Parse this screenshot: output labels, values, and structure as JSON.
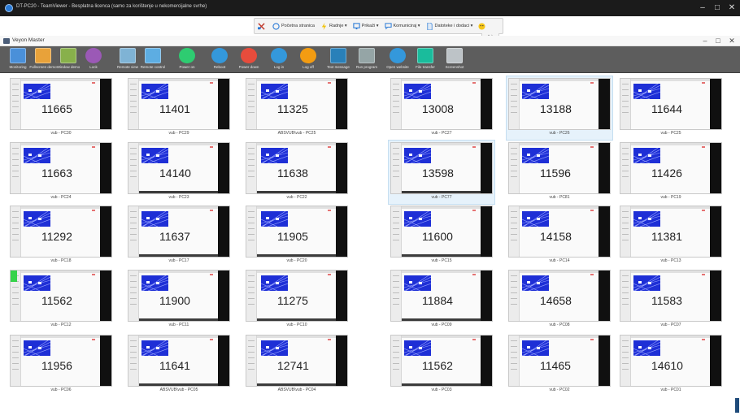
{
  "teamviewer": {
    "title": "DT-PC20 - TeamViewer - Besplatna licenca (samo za korištenje u nekomercijalne svrhe)",
    "toolbar": [
      {
        "label": "Početna stranica",
        "icon": "home-icon"
      },
      {
        "label": "Radnje",
        "icon": "bolt-icon"
      },
      {
        "label": "Prikaži",
        "icon": "monitor-icon"
      },
      {
        "label": "Komuniciraj",
        "icon": "chat-icon"
      },
      {
        "label": "Datoteke i dodaci",
        "icon": "file-icon"
      }
    ]
  },
  "veyon": {
    "title": "Veyon Master",
    "toolbar": [
      {
        "label": "Monitoring",
        "icon": "monitoring-icon",
        "color": "#4a90d9"
      },
      {
        "label": "Fullscreen demo",
        "icon": "fullscreen-demo-icon",
        "color": "#e8a23a"
      },
      {
        "label": "Window demo",
        "icon": "window-demo-icon",
        "color": "#88b04b"
      },
      {
        "label": "Lock",
        "icon": "lock-icon",
        "color": "#9b59b6"
      },
      {
        "label": "Remote view",
        "icon": "remote-view-icon",
        "color": "#7fb3d5"
      },
      {
        "label": "Remote control",
        "icon": "remote-control-icon",
        "color": "#5dade2"
      },
      {
        "label": "Power on",
        "icon": "power-on-icon",
        "color": "#2ecc71"
      },
      {
        "label": "Reboot",
        "icon": "reboot-icon",
        "color": "#3498db"
      },
      {
        "label": "Power down",
        "icon": "power-down-icon",
        "color": "#e74c3c"
      },
      {
        "label": "Log in",
        "icon": "login-icon",
        "color": "#3498db"
      },
      {
        "label": "Log off",
        "icon": "logoff-icon",
        "color": "#f39c12"
      },
      {
        "label": "Text message",
        "icon": "message-icon",
        "color": "#2980b9"
      },
      {
        "label": "Run program",
        "icon": "run-program-icon",
        "color": "#95a5a6"
      },
      {
        "label": "Open website",
        "icon": "website-icon",
        "color": "#3498db"
      },
      {
        "label": "File transfer",
        "icon": "file-transfer-icon",
        "color": "#1abc9c"
      },
      {
        "label": "Screenshot",
        "icon": "screenshot-icon",
        "color": "#bdc3c7"
      }
    ]
  },
  "computers": [
    {
      "number": "11665",
      "name": "vub - PC30"
    },
    {
      "number": "11401",
      "name": "vub - PC29"
    },
    {
      "number": "11325",
      "name": "ABSVUB\\vub - PC25"
    },
    {
      "number": "13008",
      "name": "vub - PC27"
    },
    {
      "number": "13188",
      "name": "vub - PC26"
    },
    {
      "number": "11644",
      "name": "vub - PC25"
    },
    {
      "number": "11663",
      "name": "vub - PC24"
    },
    {
      "number": "14140",
      "name": "vub - PC23"
    },
    {
      "number": "11638",
      "name": "vub - PC22"
    },
    {
      "number": "13598",
      "name": "vub - PC77"
    },
    {
      "number": "11596",
      "name": "vub - PC81"
    },
    {
      "number": "11426",
      "name": "vub - PC19"
    },
    {
      "number": "11292",
      "name": "vub - PC18"
    },
    {
      "number": "11637",
      "name": "vub - PC17"
    },
    {
      "number": "11905",
      "name": "vub - PC20"
    },
    {
      "number": "11600",
      "name": "vub - PC15"
    },
    {
      "number": "14158",
      "name": "vub - PC14"
    },
    {
      "number": "11381",
      "name": "vub - PC13"
    },
    {
      "number": "11562",
      "name": "vub - PC12"
    },
    {
      "number": "11900",
      "name": "vub - PC11"
    },
    {
      "number": "11275",
      "name": "vub - PC10"
    },
    {
      "number": "11884",
      "name": "vub - PC09"
    },
    {
      "number": "14658",
      "name": "vub - PC08"
    },
    {
      "number": "11583",
      "name": "vub - PC07"
    },
    {
      "number": "11956",
      "name": "vub - PC06"
    },
    {
      "number": "11641",
      "name": "ABSVUB\\vub - PC05"
    },
    {
      "number": "12741",
      "name": "ABSVUB\\vub - PC04"
    },
    {
      "number": "11562",
      "name": "vub - PC03"
    },
    {
      "number": "11465",
      "name": "vub - PC02"
    },
    {
      "number": "14610",
      "name": "vub - PC01"
    }
  ]
}
